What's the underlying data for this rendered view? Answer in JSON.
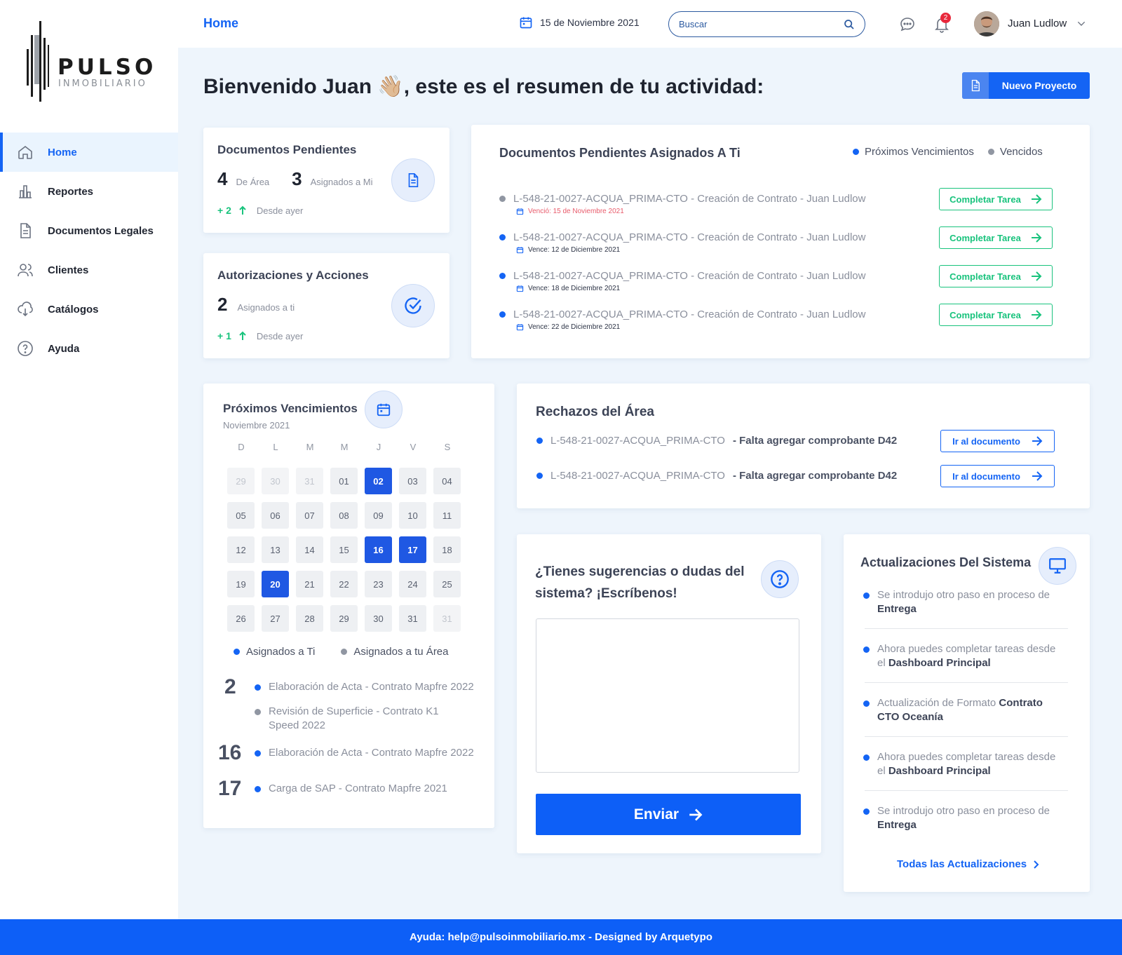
{
  "brand": {
    "name": "PULSO",
    "sub": "INMOBILIARIO"
  },
  "nav": [
    {
      "label": "Home",
      "icon": "home-icon"
    },
    {
      "label": "Reportes",
      "icon": "bar-chart-icon"
    },
    {
      "label": "Documentos Legales",
      "icon": "document-icon"
    },
    {
      "label": "Clientes",
      "icon": "users-icon"
    },
    {
      "label": "Catálogos",
      "icon": "cloud-download-icon"
    },
    {
      "label": "Ayuda",
      "icon": "help-icon"
    }
  ],
  "topbar": {
    "page": "Home",
    "date": "15 de Noviembre 2021",
    "search_placeholder": "Buscar",
    "notifications": "2",
    "user": "Juan Ludlow"
  },
  "welcome": {
    "greeting": "Bienvenido Juan 👋🏼, este es el resumen de tu actividad:"
  },
  "new_project": "Nuevo Proyecto",
  "pending": {
    "title": "Documentos Pendientes",
    "area_count": "4",
    "area_label": "De Área",
    "mine_count": "3",
    "mine_label": "Asignados a Mi",
    "delta": "+ 2",
    "delta_label": "Desde ayer"
  },
  "auth": {
    "title": "Autorizaciones y Acciones",
    "count": "2",
    "label": "Asignados a ti",
    "delta": "+ 1",
    "delta_label": "Desde ayer"
  },
  "assigned": {
    "title": "Documentos Pendientes Asignados A Ti",
    "legend_upcoming": "Próximos Vencimientos",
    "legend_overdue": "Vencidos",
    "button": "Completar Tarea",
    "tasks": [
      {
        "text": "L-548-21-0027-ACQUA_PRIMA-CTO  - Creación de Contrato  - Juan Ludlow",
        "date": "Venció: 15 de Noviembre 2021"
      },
      {
        "text": "L-548-21-0027-ACQUA_PRIMA-CTO  - Creación de Contrato  - Juan Ludlow",
        "date": "Vence: 12 de Diciembre 2021"
      },
      {
        "text": "L-548-21-0027-ACQUA_PRIMA-CTO  - Creación de Contrato  - Juan Ludlow",
        "date": "Vence: 18 de Diciembre 2021"
      },
      {
        "text": "L-548-21-0027-ACQUA_PRIMA-CTO  - Creación de Contrato  - Juan Ludlow",
        "date": "Vence: 22 de Diciembre 2021"
      }
    ]
  },
  "calendar": {
    "title": "Próximos Vencimientos",
    "month": "Noviembre 2021",
    "weekdays": [
      "D",
      "L",
      "M",
      "M",
      "J",
      "V",
      "S"
    ],
    "days": [
      "29",
      "30",
      "31",
      "01",
      "02",
      "03",
      "04",
      "05",
      "06",
      "07",
      "08",
      "09",
      "10",
      "11",
      "12",
      "13",
      "14",
      "15",
      "16",
      "17",
      "18",
      "19",
      "20",
      "21",
      "22",
      "23",
      "24",
      "25",
      "26",
      "27",
      "28",
      "29",
      "30",
      "31",
      "31"
    ],
    "legend_mine": "Asignados a Ti",
    "legend_area": "Asignados a tu Área",
    "events": [
      {
        "day": "2",
        "items": [
          "Elaboración de Acta - Contrato Mapfre 2022",
          "Revisión de Superficie - Contrato K1 Speed 2022"
        ]
      },
      {
        "day": "16",
        "items": [
          "Elaboración de Acta  - Contrato Mapfre 2022"
        ]
      },
      {
        "day": "17",
        "items": [
          "Carga de SAP  - Contrato Mapfre 2021"
        ]
      }
    ]
  },
  "rejections": {
    "title": "Rechazos del Área",
    "button": "Ir al documento",
    "items": [
      {
        "code": "L-548-21-0027-ACQUA_PRIMA-CTO",
        "reason": "- Falta agregar comprobante D42"
      },
      {
        "code": "L-548-21-0027-ACQUA_PRIMA-CTO",
        "reason": "- Falta agregar comprobante D42"
      }
    ]
  },
  "feedback": {
    "title_line1": "¿Tienes sugerencias o dudas del",
    "title_line2": "sistema? ¡Escríbenos!",
    "send": "Enviar"
  },
  "updates": {
    "title": "Actualizaciones Del Sistema",
    "items": [
      {
        "pre": "Se introdujo otro paso en proceso de ",
        "bold": "Entrega"
      },
      {
        "pre": "Ahora puedes completar tareas desde el ",
        "bold": "Dashboard Principal"
      },
      {
        "pre": "Actualización de Formato ",
        "bold": "Contrato CTO Oceanía"
      },
      {
        "pre": "Ahora puedes completar tareas desde el ",
        "bold": "Dashboard Principal"
      },
      {
        "pre": "Se introdujo otro paso en proceso de ",
        "bold": "Entrega"
      }
    ],
    "all": "Todas las Actualizaciones"
  },
  "footer": "Ayuda: help@pulsoinmobiliario.mx - Designed by Arquetypo",
  "colors": {
    "primary": "#1464f4",
    "success": "#19c37d",
    "danger": "#e85b6b",
    "footer": "#0d5ff7"
  }
}
